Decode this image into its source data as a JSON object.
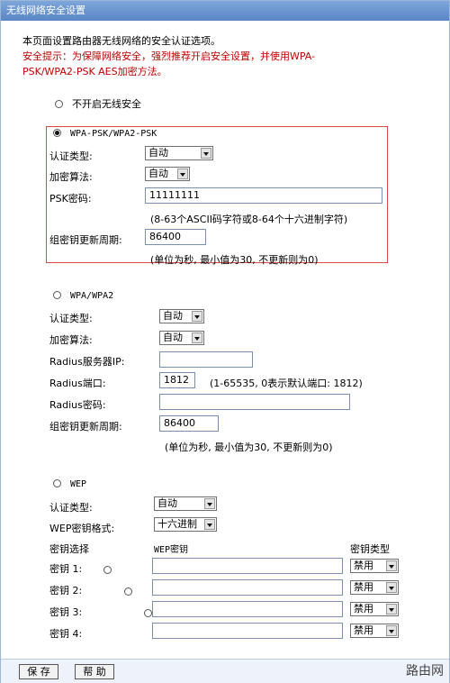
{
  "window_title": "无线网络安全设置",
  "intro": {
    "line1": "本页面设置路由器无线网络的安全认证选项。",
    "warn_line1": "安全提示：为保障网络安全，强烈推荐开启安全设置，并使用WPA-",
    "warn_line2": "PSK/WPA2-PSK AES加密方法。"
  },
  "no_security": {
    "label": "不开启无线安全",
    "selected": false
  },
  "wpa_psk": {
    "label": "WPA-PSK/WPA2-PSK",
    "selected": true,
    "auth_label": "认证类型:",
    "auth_value": "自动",
    "enc_label": "加密算法:",
    "enc_value": "自动",
    "psk_label": "PSK密码:",
    "psk_value": "11111111",
    "psk_hint": "(8-63个ASCII码字符或8-64个十六进制字符)",
    "renew_label": "组密钥更新周期:",
    "renew_value": "86400",
    "renew_hint": "(单位为秒, 最小值为30, 不更新则为0)"
  },
  "wpa": {
    "label": "WPA/WPA2",
    "selected": false,
    "auth_label": "认证类型:",
    "auth_value": "自动",
    "enc_label": "加密算法:",
    "enc_value": "自动",
    "radius_ip_label": "Radius服务器IP:",
    "radius_ip_value": "",
    "radius_port_label": "Radius端口:",
    "radius_port_value": "1812",
    "radius_port_hint": "(1-65535, 0表示默认端口: 1812)",
    "radius_pwd_label": "Radius密码:",
    "radius_pwd_value": "",
    "renew_label": "组密钥更新周期:",
    "renew_value": "86400",
    "renew_hint": "(单位为秒, 最小值为30, 不更新则为0)"
  },
  "wep": {
    "label": "WEP",
    "selected": false,
    "auth_label": "认证类型:",
    "auth_value": "自动",
    "format_label": "WEP密钥格式:",
    "format_value": "十六进制",
    "col_select": "密钥选择",
    "col_key": "WEP密钥",
    "col_type": "密钥类型",
    "keys": [
      {
        "label": "密钥 1:",
        "value": "",
        "type": "禁用"
      },
      {
        "label": "密钥 2:",
        "value": "",
        "type": "禁用"
      },
      {
        "label": "密钥 3:",
        "value": "",
        "type": "禁用"
      },
      {
        "label": "密钥 4:",
        "value": "",
        "type": "禁用"
      }
    ]
  },
  "buttons": {
    "save": "保 存",
    "help": "帮 助"
  },
  "watermark": "路由网"
}
